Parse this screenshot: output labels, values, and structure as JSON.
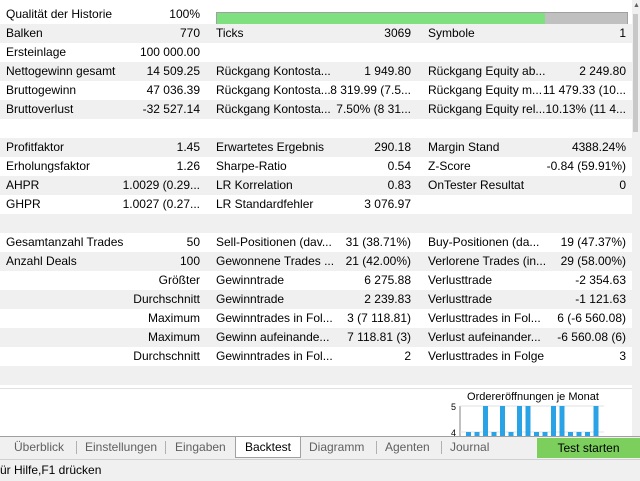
{
  "report": {
    "history_quality": {
      "label": "Qualität der Historie",
      "value": "100%",
      "fill": 1.0
    },
    "rows": [
      [
        {
          "t": "Balken"
        },
        {
          "t": "770",
          "r": 1
        },
        {
          "t": "Ticks"
        },
        {
          "t": "3069",
          "r": 1
        },
        {
          "t": "Symbole"
        },
        {
          "t": "1",
          "r": 1
        }
      ],
      [
        {
          "t": "Ersteinlage"
        },
        {
          "t": "100 000.00",
          "r": 1
        }
      ],
      [
        {
          "t": "Nettogewinn gesamt"
        },
        {
          "t": "14 509.25",
          "r": 1
        },
        {
          "t": "Rückgang Kontosta..."
        },
        {
          "t": "1 949.80",
          "r": 1
        },
        {
          "t": "Rückgang Equity ab..."
        },
        {
          "t": "2 249.80",
          "r": 1
        }
      ],
      [
        {
          "t": "Bruttogewinn"
        },
        {
          "t": "47 036.39",
          "r": 1
        },
        {
          "t": "Rückgang Kontosta..."
        },
        {
          "t": "8 319.99 (7.5...",
          "r": 1
        },
        {
          "t": "Rückgang Equity m..."
        },
        {
          "t": "11 479.33 (10...",
          "r": 1
        }
      ],
      [
        {
          "t": "Bruttoverlust"
        },
        {
          "t": "-32 527.14",
          "r": 1
        },
        {
          "t": "Rückgang Kontosta..."
        },
        {
          "t": "7.50% (8 31...",
          "r": 1
        },
        {
          "t": "Rückgang Equity rel..."
        },
        {
          "t": "10.13% (11 4...",
          "r": 1
        }
      ],
      [],
      [
        {
          "t": "Profitfaktor"
        },
        {
          "t": "1.45",
          "r": 1
        },
        {
          "t": "Erwartetes Ergebnis"
        },
        {
          "t": "290.18",
          "r": 1
        },
        {
          "t": "Margin Stand"
        },
        {
          "t": "4388.24%",
          "r": 1
        }
      ],
      [
        {
          "t": "Erholungsfaktor"
        },
        {
          "t": "1.26",
          "r": 1
        },
        {
          "t": "Sharpe-Ratio"
        },
        {
          "t": "0.54",
          "r": 1
        },
        {
          "t": "Z-Score"
        },
        {
          "t": "-0.84 (59.91%)",
          "r": 1
        }
      ],
      [
        {
          "t": "AHPR"
        },
        {
          "t": "1.0029 (0.29...",
          "r": 1
        },
        {
          "t": "LR Korrelation"
        },
        {
          "t": "0.83",
          "r": 1
        },
        {
          "t": "OnTester Resultat"
        },
        {
          "t": "0",
          "r": 1
        }
      ],
      [
        {
          "t": "GHPR"
        },
        {
          "t": "1.0027 (0.27...",
          "r": 1
        },
        {
          "t": "LR Standardfehler"
        },
        {
          "t": "3 076.97",
          "r": 1
        }
      ],
      [],
      [
        {
          "t": "Gesamtanzahl Trades"
        },
        {
          "t": "50",
          "r": 1
        },
        {
          "t": "Sell-Positionen (dav..."
        },
        {
          "t": "31 (38.71%)",
          "r": 1
        },
        {
          "t": "Buy-Positionen (da..."
        },
        {
          "t": "19 (47.37%)",
          "r": 1
        }
      ],
      [
        {
          "t": "Anzahl Deals"
        },
        {
          "t": "100",
          "r": 1
        },
        {
          "t": "Gewonnene Trades ..."
        },
        {
          "t": "21 (42.00%)",
          "r": 1
        },
        {
          "t": "Verlorene Trades (in..."
        },
        {
          "t": "29 (58.00%)",
          "r": 1
        }
      ],
      [
        {
          "t": "Größter",
          "r": 1
        },
        {
          "t": "Gewinntrade"
        },
        {
          "t": "6 275.88",
          "r": 1
        },
        {
          "t": "Verlusttrade"
        },
        {
          "t": "-2 354.63",
          "r": 1
        }
      ],
      [
        {
          "t": "Durchschnitt",
          "r": 1
        },
        {
          "t": "Gewinntrade"
        },
        {
          "t": "2 239.83",
          "r": 1
        },
        {
          "t": "Verlusttrade"
        },
        {
          "t": "-1 121.63",
          "r": 1
        }
      ],
      [
        {
          "t": "Maximum",
          "r": 1
        },
        {
          "t": "Gewinntrades in Fol..."
        },
        {
          "t": "3 (7 118.81)",
          "r": 1
        },
        {
          "t": "Verlusttrades in Fol..."
        },
        {
          "t": "6 (-6 560.08)",
          "r": 1
        }
      ],
      [
        {
          "t": "Maximum",
          "r": 1
        },
        {
          "t": "Gewinn aufeinande..."
        },
        {
          "t": "7 118.81 (3)",
          "r": 1
        },
        {
          "t": "Verlust aufeinander..."
        },
        {
          "t": "-6 560.08 (6)",
          "r": 1
        }
      ],
      [
        {
          "t": "Durchschnitt",
          "r": 1
        },
        {
          "t": "Gewinntrades in Fol..."
        },
        {
          "t": "2",
          "r": 1
        },
        {
          "t": "Verlusttrades in Folge"
        },
        {
          "t": "3",
          "r": 1
        }
      ],
      []
    ]
  },
  "chart": {
    "title": "Ordereröffnungen je Monat",
    "y_ticks": [
      "5",
      "4"
    ],
    "y_max": 5,
    "bars": [
      4,
      4,
      5,
      4,
      5,
      4,
      5,
      5,
      4,
      4,
      5,
      5,
      4,
      4,
      4,
      5
    ],
    "bar_color": "#29a3e6"
  },
  "tabs": [
    {
      "label": "Überblick",
      "active": false
    },
    {
      "label": "Einstellungen",
      "active": false
    },
    {
      "label": "Eingaben",
      "active": false
    },
    {
      "label": "Backtest",
      "active": true
    },
    {
      "label": "Diagramm",
      "active": false
    },
    {
      "label": "Agenten",
      "active": false
    },
    {
      "label": "Journal",
      "active": false
    }
  ],
  "start_button": "Test starten",
  "status": "ür Hilfe,F1 drücken"
}
